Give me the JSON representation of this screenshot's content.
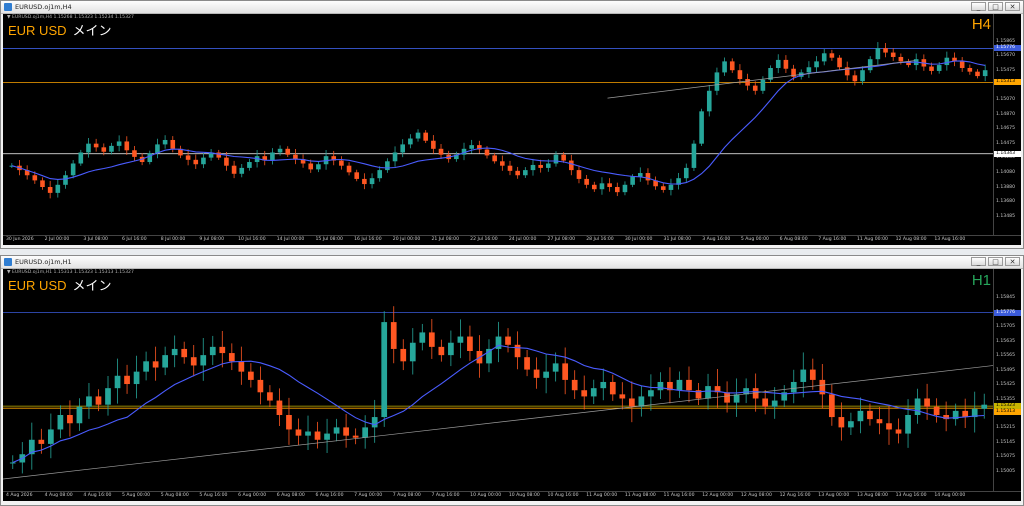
{
  "colors": {
    "background": "#000000",
    "bull": "#26a69a",
    "bear": "#ff5722",
    "ma": "#4a5cff",
    "trendline": "#9e9e9e",
    "level_orange": "#ffa500",
    "level_yellow": "#c8b400",
    "level_white": "#ffffff",
    "level_blue": "#3b5bdb",
    "symbol_text": "#ffa500",
    "h4_label": "#ffa500",
    "h1_label": "#26a65b"
  },
  "top_window": {
    "title": "EURUSD.oj1m,H4",
    "buttons": [
      "_",
      "□",
      "✕"
    ],
    "info_line": "▼ EURUSD.oj1m,H4  1.15268 1.15323 1.15234 1.15327",
    "symbol_label": "EUR USD",
    "main_label": "メイン",
    "timeframe_label": "H4",
    "price_ticks": [
      "1.15865",
      "1.15670",
      "1.15475",
      "1.15275",
      "1.15070",
      "1.14870",
      "1.14675",
      "1.14475",
      "1.14280",
      "1.14080",
      "1.13880",
      "1.13680",
      "1.13485"
    ],
    "price_labels": [
      {
        "text": "1.15776",
        "color": "#3b5bdb"
      },
      {
        "text": "1.15313",
        "color": "#ffa500"
      },
      {
        "text": "1.14343",
        "color": "#ffffff"
      }
    ],
    "time_ticks": [
      "30 Jun 2026",
      "2 Jul 00:00",
      "3 Jul 08:00",
      "6 Jul 16:00",
      "8 Jul 00:00",
      "9 Jul 08:00",
      "10 Jul 16:00",
      "14 Jul 00:00",
      "15 Jul 08:00",
      "16 Jul 16:00",
      "20 Jul 00:00",
      "21 Jul 08:00",
      "22 Jul 16:00",
      "24 Jul 00:00",
      "27 Jul 08:00",
      "28 Jul 16:00",
      "30 Jul 00:00",
      "31 Jul 08:00",
      "3 Aug 16:00",
      "5 Aug 00:00",
      "6 Aug 08:00",
      "7 Aug 16:00",
      "11 Aug 00:00",
      "12 Aug 08:00",
      "13 Aug 16:00"
    ],
    "price_range": [
      1.134,
      1.16
    ],
    "levels": [
      {
        "price": 1.15776,
        "color": "#3b5bdb"
      },
      {
        "price": 1.15313,
        "color": "#ffa500"
      },
      {
        "price": 1.14343,
        "color": "#ffffff"
      }
    ],
    "trendline": {
      "from": [
        0.61,
        1.151
      ],
      "to": [
        0.92,
        1.1561
      ]
    },
    "series": [
      1.1418,
      1.1412,
      1.1405,
      1.1398,
      1.1389,
      1.1381,
      1.1392,
      1.1405,
      1.1421,
      1.1436,
      1.1448,
      1.1443,
      1.1437,
      1.1445,
      1.1451,
      1.1439,
      1.143,
      1.1423,
      1.1435,
      1.1447,
      1.1453,
      1.1441,
      1.1432,
      1.1426,
      1.142,
      1.1429,
      1.1436,
      1.1429,
      1.1418,
      1.1407,
      1.1415,
      1.1423,
      1.1431,
      1.1425,
      1.1436,
      1.1441,
      1.1433,
      1.1427,
      1.1421,
      1.1413,
      1.142,
      1.1431,
      1.1425,
      1.1418,
      1.1409,
      1.14,
      1.1393,
      1.1401,
      1.1412,
      1.1424,
      1.1436,
      1.1447,
      1.1455,
      1.1463,
      1.1452,
      1.1441,
      1.1433,
      1.1427,
      1.1433,
      1.1441,
      1.1446,
      1.144,
      1.1432,
      1.1424,
      1.1418,
      1.1411,
      1.1405,
      1.1412,
      1.1419,
      1.1415,
      1.1421,
      1.1433,
      1.1425,
      1.1412,
      1.14,
      1.1392,
      1.1386,
      1.1394,
      1.1389,
      1.1382,
      1.1392,
      1.1403,
      1.1408,
      1.1398,
      1.139,
      1.1385,
      1.1392,
      1.1401,
      1.1415,
      1.1448,
      1.1492,
      1.152,
      1.1545,
      1.156,
      1.1548,
      1.1536,
      1.1527,
      1.152,
      1.1535,
      1.1551,
      1.1562,
      1.155,
      1.1539,
      1.1545,
      1.1552,
      1.156,
      1.1571,
      1.1565,
      1.1552,
      1.1541,
      1.1533,
      1.1548,
      1.1563,
      1.1578,
      1.1572,
      1.1566,
      1.156,
      1.1555,
      1.1563,
      1.1553,
      1.1547,
      1.1555,
      1.1565,
      1.156,
      1.1551,
      1.1546,
      1.154,
      1.1548
    ],
    "ma_period": 13
  },
  "bottom_window": {
    "title": "EURUSD.oj1m,H1",
    "buttons": [
      "_",
      "□",
      "✕"
    ],
    "info_line": "▼ EURUSD.oj1m,H1  1.15313 1.15323 1.15313 1.15327",
    "symbol_label": "EUR USD",
    "main_label": "メイン",
    "timeframe_label": "H1",
    "price_ticks": [
      "1.15845",
      "1.15775",
      "1.15705",
      "1.15635",
      "1.15565",
      "1.15495",
      "1.15425",
      "1.15355",
      "1.15285",
      "1.15215",
      "1.15145",
      "1.15075",
      "1.15005"
    ],
    "price_labels": [
      {
        "text": "1.15776",
        "color": "#3b5bdb"
      },
      {
        "text": "1.15323",
        "color": "#c8b400"
      },
      {
        "text": "1.15313",
        "color": "#ffa500"
      }
    ],
    "time_ticks": [
      "4 Aug 2026",
      "4 Aug 08:00",
      "4 Aug 16:00",
      "5 Aug 00:00",
      "5 Aug 08:00",
      "5 Aug 16:00",
      "6 Aug 00:00",
      "6 Aug 08:00",
      "6 Aug 16:00",
      "7 Aug 00:00",
      "7 Aug 08:00",
      "7 Aug 16:00",
      "10 Aug 00:00",
      "10 Aug 08:00",
      "10 Aug 16:00",
      "11 Aug 00:00",
      "11 Aug 08:00",
      "11 Aug 16:00",
      "12 Aug 00:00",
      "12 Aug 08:00",
      "12 Aug 16:00",
      "13 Aug 00:00",
      "13 Aug 08:00",
      "13 Aug 16:00",
      "14 Aug 00:00"
    ],
    "price_range": [
      1.1497,
      1.159
    ],
    "levels": [
      {
        "price": 1.15776,
        "color": "#3b5bdb"
      },
      {
        "price": 1.15323,
        "color": "#c8b400"
      },
      {
        "price": 1.15313,
        "color": "#ffa500"
      }
    ],
    "trendline": {
      "from": [
        0.0,
        1.1497
      ],
      "to": [
        1.0,
        1.1552
      ]
    },
    "series": [
      1.1505,
      1.1509,
      1.1516,
      1.1514,
      1.1521,
      1.1528,
      1.1524,
      1.1532,
      1.1537,
      1.1533,
      1.1541,
      1.1547,
      1.1543,
      1.1549,
      1.1554,
      1.1551,
      1.1557,
      1.156,
      1.1556,
      1.1552,
      1.1557,
      1.1561,
      1.1558,
      1.1554,
      1.1549,
      1.1545,
      1.1539,
      1.1535,
      1.1528,
      1.1521,
      1.1518,
      1.152,
      1.1516,
      1.1519,
      1.1522,
      1.1518,
      1.1517,
      1.1522,
      1.1527,
      1.1573,
      1.156,
      1.1554,
      1.1563,
      1.1568,
      1.1561,
      1.1557,
      1.1563,
      1.1566,
      1.1559,
      1.1553,
      1.156,
      1.1566,
      1.1562,
      1.1556,
      1.155,
      1.1546,
      1.1549,
      1.1553,
      1.1545,
      1.154,
      1.1537,
      1.1541,
      1.1544,
      1.1538,
      1.1536,
      1.1532,
      1.1537,
      1.154,
      1.1544,
      1.154,
      1.1545,
      1.154,
      1.1536,
      1.1542,
      1.1539,
      1.1534,
      1.1538,
      1.1541,
      1.1536,
      1.1532,
      1.1535,
      1.1539,
      1.1544,
      1.155,
      1.1545,
      1.1538,
      1.1527,
      1.1522,
      1.1525,
      1.153,
      1.1526,
      1.1524,
      1.1521,
      1.1519,
      1.1528,
      1.1536,
      1.1532,
      1.1528,
      1.1526,
      1.153,
      1.1527,
      1.1531,
      1.1533
    ],
    "ma_period": 13
  }
}
